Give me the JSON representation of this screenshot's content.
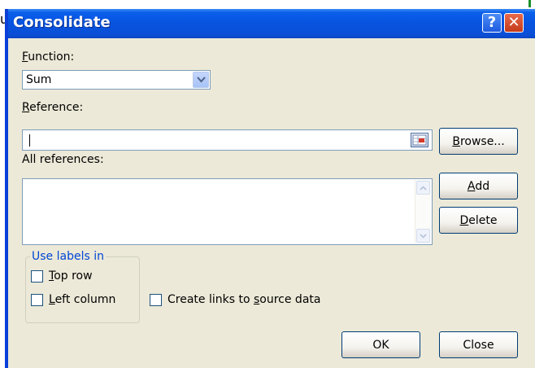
{
  "background": {
    "partial_text": "u"
  },
  "dialog": {
    "title": "Consolidate",
    "help_glyph": "?",
    "close_glyph": "✕"
  },
  "function": {
    "label_ul": "F",
    "label_rest": "unction:",
    "value": "Sum"
  },
  "reference": {
    "label_ul": "R",
    "label_rest": "eference:",
    "value": ""
  },
  "all_references": {
    "label": "All references:"
  },
  "buttons": {
    "browse_ul": "B",
    "browse_rest": "rowse...",
    "add_ul": "A",
    "add_rest": "dd",
    "delete_ul": "D",
    "delete_rest": "elete",
    "ok": "OK",
    "close": "Close"
  },
  "use_labels": {
    "legend": "Use labels in",
    "top_row_ul": "T",
    "top_row_rest": "op row",
    "top_row_checked": false,
    "left_column_ul": "L",
    "left_column_rest": "eft column",
    "left_column_checked": false
  },
  "create_links": {
    "before": "Create links to ",
    "ul": "s",
    "after": "ource data",
    "checked": false
  },
  "colors": {
    "title_bar": "#0a5fea",
    "dialog_face": "#ece9d8",
    "group_legend": "#0046d5",
    "close_button": "#c43a1a"
  }
}
